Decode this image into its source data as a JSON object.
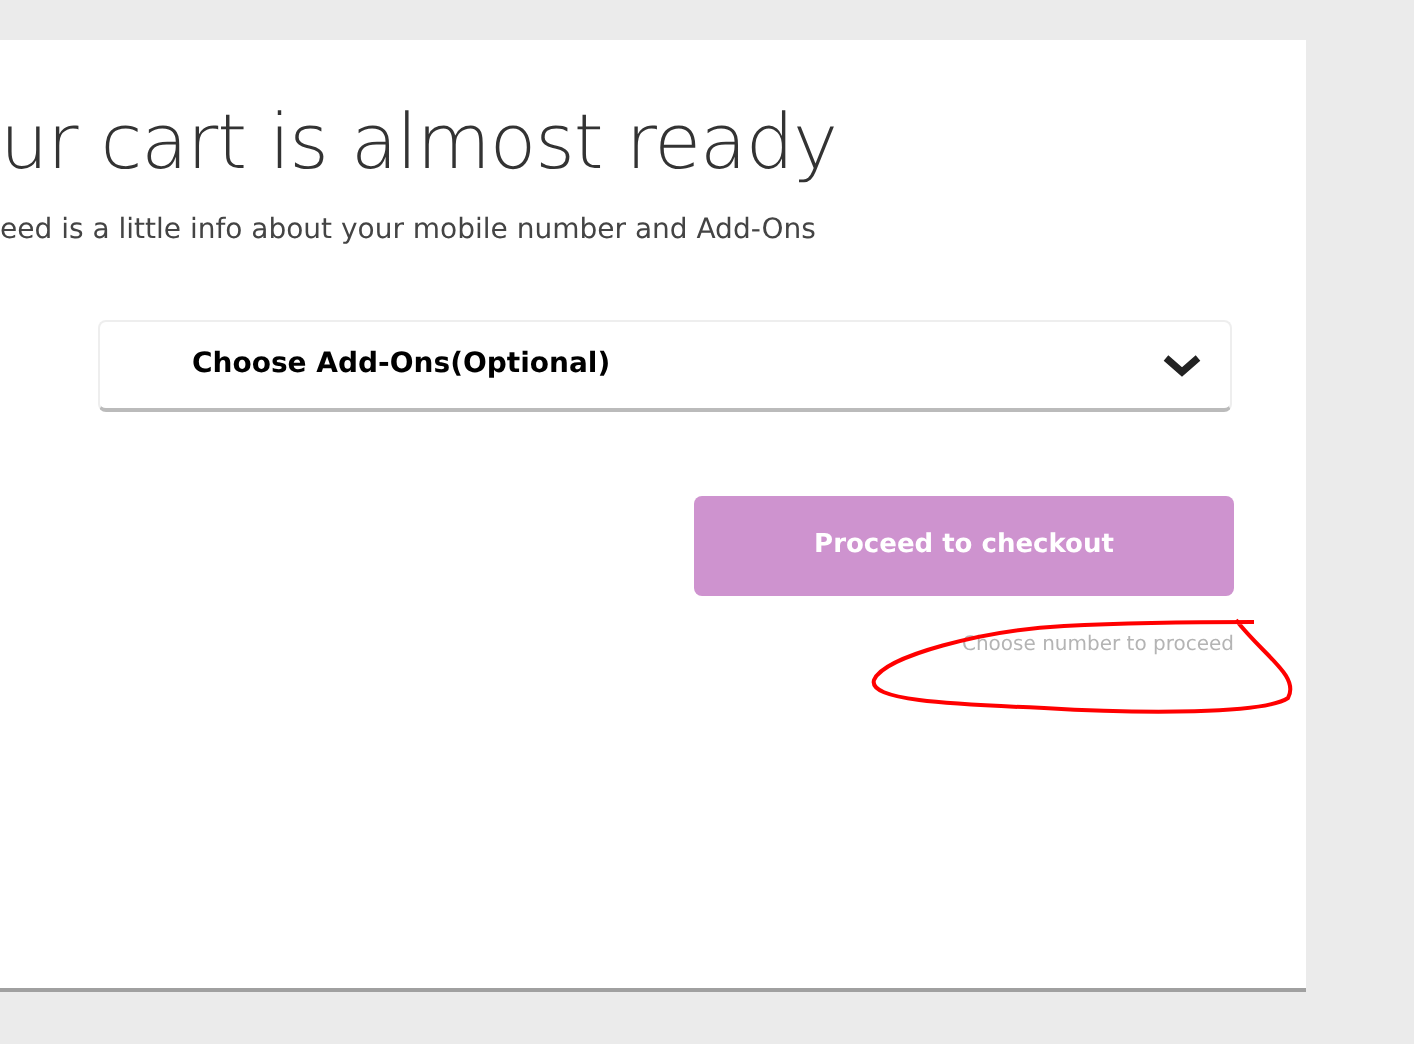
{
  "heading": "ur cart is almost ready",
  "subtitle": "eed is a little info about your mobile number and Add-Ons",
  "addons": {
    "label": "Choose Add-Ons(Optional)",
    "expanded": false
  },
  "checkout": {
    "label": "Proceed to checkout",
    "disabled": true
  },
  "hint": "Choose number to proceed"
}
